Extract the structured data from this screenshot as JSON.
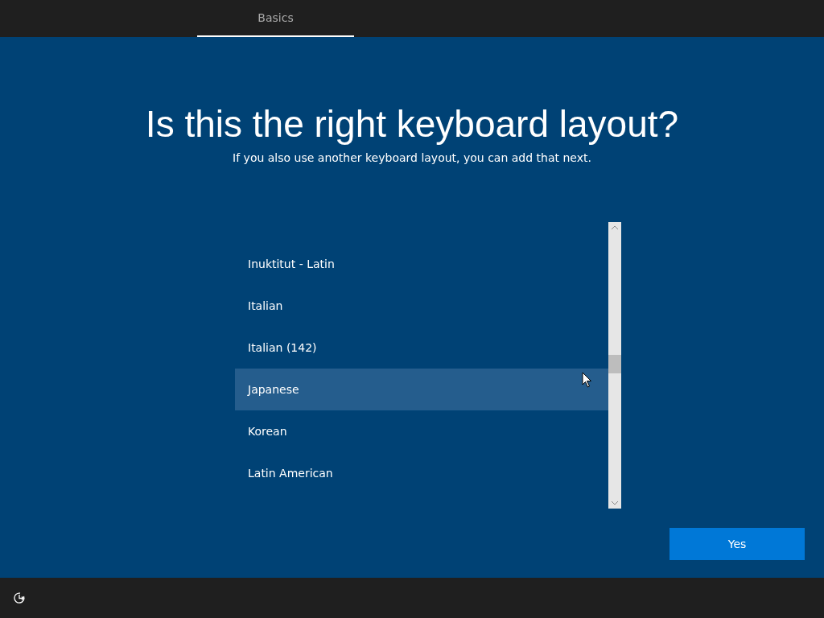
{
  "tabs": [
    {
      "label": "Basics",
      "selected": true
    }
  ],
  "heading": "Is this the right keyboard layout?",
  "subheading": "If you also use another keyboard layout, you can add that next.",
  "layouts": [
    {
      "label": "Inuktitut - Latin",
      "selected": false
    },
    {
      "label": "Italian",
      "selected": false
    },
    {
      "label": "Italian (142)",
      "selected": false
    },
    {
      "label": "Japanese",
      "selected": true
    },
    {
      "label": "Korean",
      "selected": false
    },
    {
      "label": "Latin American",
      "selected": false
    }
  ],
  "buttons": [
    {
      "label": "Yes"
    }
  ]
}
